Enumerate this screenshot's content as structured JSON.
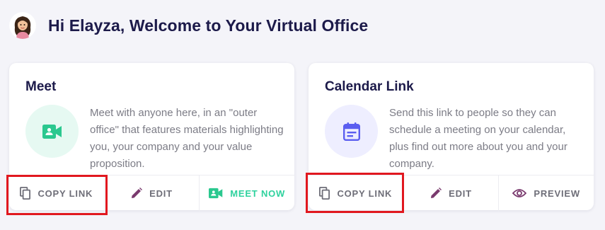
{
  "header": {
    "greeting": "Hi Elayza, Welcome to Your Virtual Office",
    "avatar_icon": "avatar-cartoon-woman"
  },
  "cards": [
    {
      "title": "Meet",
      "description": "Meet with anyone here, in an \"outer office\" that features materials highlighting you, your company and your value proposition.",
      "icon": "video-camera-icon",
      "icon_color": "#2bc88f",
      "icon_bg": "#e6f9f2",
      "actions": [
        {
          "label": "COPY LINK",
          "icon": "copy-icon"
        },
        {
          "label": "EDIT",
          "icon": "pencil-icon"
        },
        {
          "label": "MEET NOW",
          "icon": "video-camera-icon"
        }
      ]
    },
    {
      "title": "Calendar Link",
      "description": "Send this link to people so they can schedule a meeting on your calendar, plus find out more about you and your company.",
      "icon": "calendar-icon",
      "icon_color": "#5b5ef0",
      "icon_bg": "#eeeeff",
      "actions": [
        {
          "label": "COPY LINK",
          "icon": "copy-icon"
        },
        {
          "label": "EDIT",
          "icon": "pencil-icon"
        },
        {
          "label": "PREVIEW",
          "icon": "eye-icon"
        }
      ]
    }
  ],
  "colors": {
    "title": "#1c1a4a",
    "text_muted": "#7c7c86",
    "accent_purple": "#7a3a6e",
    "accent_green": "#2fd29e",
    "highlight_red": "#e1181f",
    "background": "#f4f4f9"
  }
}
